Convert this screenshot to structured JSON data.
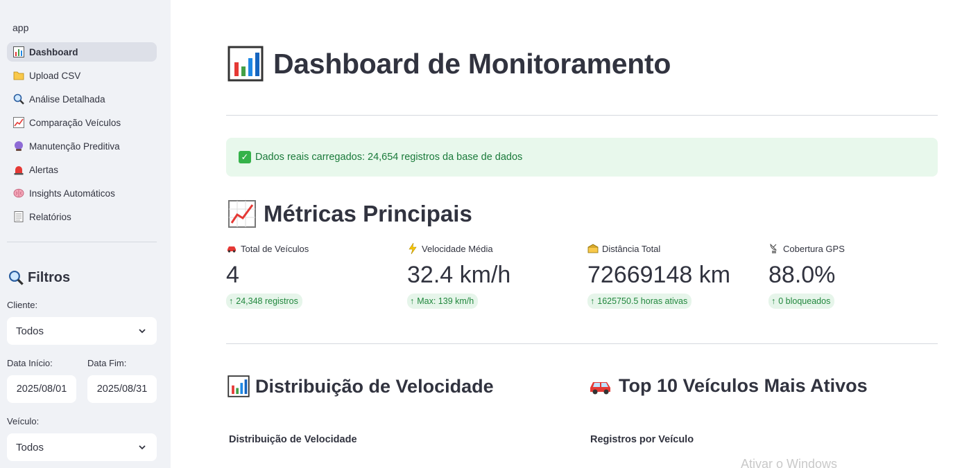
{
  "sidebar": {
    "app_label": "app",
    "nav": [
      {
        "label": "Dashboard",
        "icon": "bar-chart-icon",
        "active": true
      },
      {
        "label": "Upload CSV",
        "icon": "folder-icon"
      },
      {
        "label": "Análise Detalhada",
        "icon": "magnifier-icon"
      },
      {
        "label": "Comparação Veículos",
        "icon": "trend-chart-icon"
      },
      {
        "label": "Manutenção Preditiva",
        "icon": "crystal-ball-icon"
      },
      {
        "label": "Alertas",
        "icon": "siren-icon"
      },
      {
        "label": "Insights Automáticos",
        "icon": "brain-icon"
      },
      {
        "label": "Relatórios",
        "icon": "document-icon"
      }
    ],
    "filters": {
      "title": "Filtros",
      "cliente_label": "Cliente:",
      "cliente_value": "Todos",
      "data_inicio_label": "Data Início:",
      "data_inicio_value": "2025/08/01",
      "data_fim_label": "Data Fim:",
      "data_fim_value": "2025/08/31",
      "veiculo_label": "Veículo:",
      "veiculo_value": "Todos"
    }
  },
  "main": {
    "title": "Dashboard de Monitoramento",
    "success_message": "Dados reais carregados: 24,654 registros da base de dados",
    "metrics_title": "Métricas Principais",
    "metrics": [
      {
        "label": "Total de Veículos",
        "icon": "car-icon",
        "value": "4",
        "delta": "24,348 registros"
      },
      {
        "label": "Velocidade Média",
        "icon": "lightning-icon",
        "value": "32.4 km/h",
        "delta": "Max: 139 km/h"
      },
      {
        "label": "Distância Total",
        "icon": "route-icon",
        "value": "72669148 km",
        "delta": "1625750.5 horas ativas"
      },
      {
        "label": "Cobertura GPS",
        "icon": "satellite-icon",
        "value": "88.0%",
        "delta": "0 bloqueados"
      }
    ],
    "speed_section_title": "Distribuição de Velocidade",
    "speed_chart_title": "Distribuição de Velocidade",
    "top_section_title": "Top 10 Veículos Mais Ativos",
    "top_chart_title": "Registros por Veículo",
    "watermark": "Ativar o Windows"
  },
  "colors": {
    "sidebar_bg": "#f0f2f6",
    "success_bg": "#e8f8ec",
    "success_text": "#1a7a3a",
    "delta_bg": "#e6f5ea",
    "delta_text": "#21873d"
  }
}
